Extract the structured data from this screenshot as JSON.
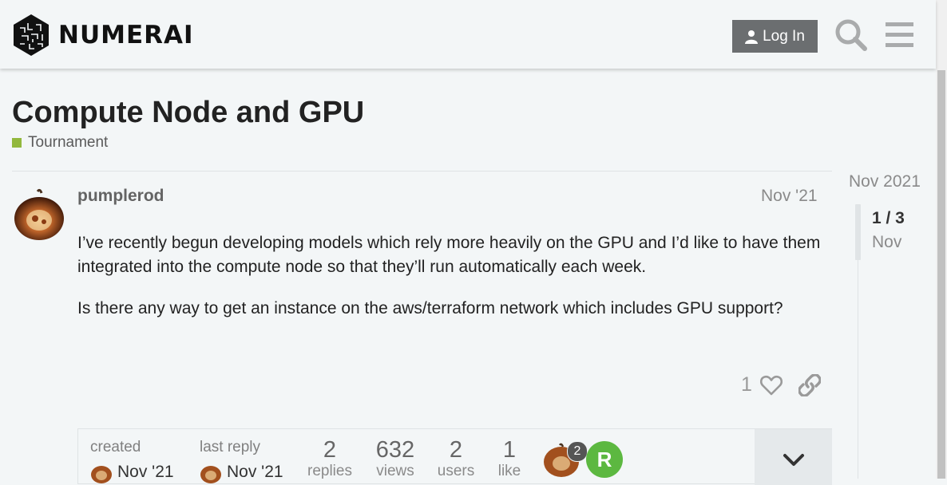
{
  "header": {
    "brand": "NUMERAI",
    "login_label": "Log In",
    "search_icon": "search-icon",
    "menu_icon": "hamburger-menu-icon"
  },
  "topic": {
    "title": "Compute Node and GPU",
    "category": "Tournament",
    "category_color": "#92b83d"
  },
  "post": {
    "username": "pumplerod",
    "date": "Nov '21",
    "paragraphs": [
      "I’ve recently begun developing models which rely more heavily on the GPU and I’d like to have them integrated into the compute node so that they’ll run automatically each week.",
      "Is there any way to get an instance on the aws/terraform network which includes GPU support?"
    ],
    "likes": "1"
  },
  "topic_map": {
    "created_label": "created",
    "created_date": "Nov '21",
    "last_reply_label": "last reply",
    "last_reply_date": "Nov '21",
    "replies_num": "2",
    "replies_label": "replies",
    "views_num": "632",
    "views_label": "views",
    "users_num": "2",
    "users_label": "users",
    "likes_num": "1",
    "likes_label": "like",
    "participant_badge": "2",
    "participant_initial": "R",
    "participant_color": "#5cb840"
  },
  "timeline": {
    "date": "Nov 2021",
    "position": "1 / 3",
    "month": "Nov"
  }
}
